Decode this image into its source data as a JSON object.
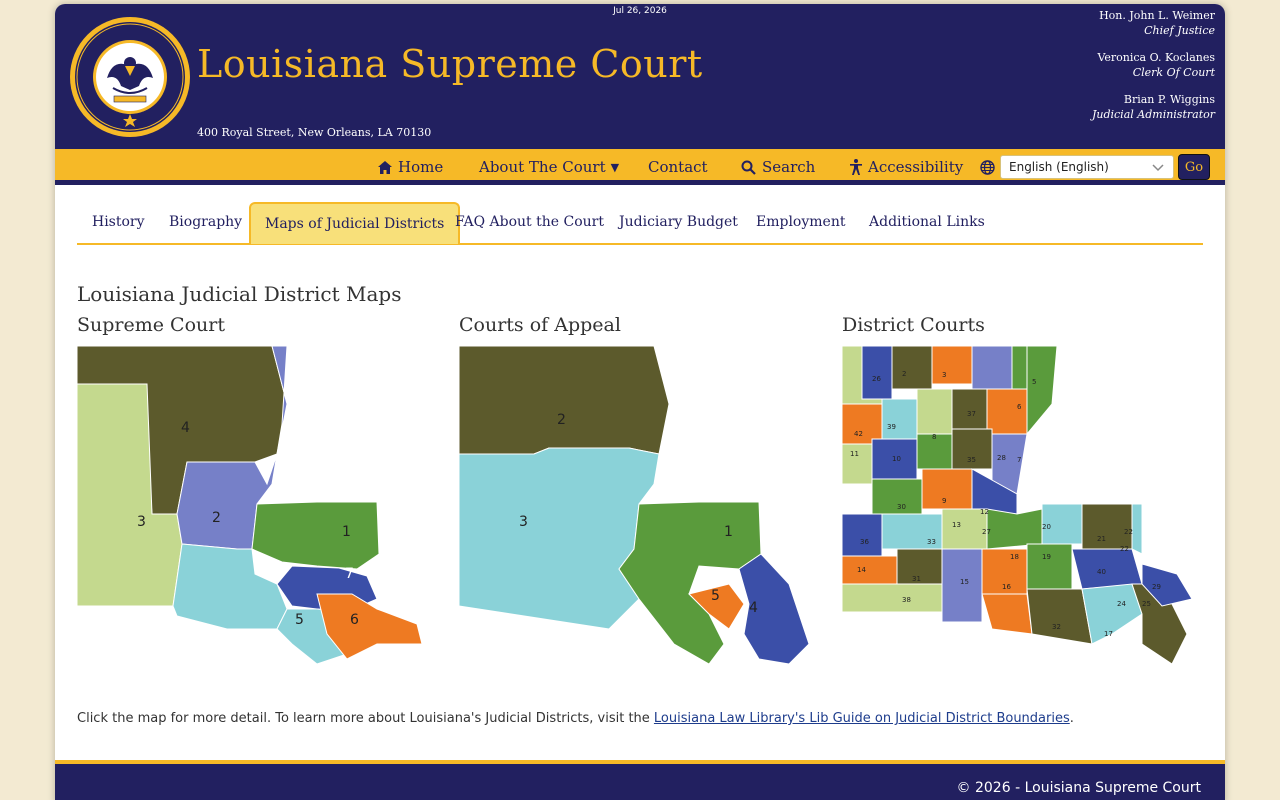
{
  "header": {
    "date": "Jul 26, 2026",
    "title": "Louisiana Supreme Court",
    "address": "400 Royal Street, New Orleans, LA 70130",
    "officials": [
      {
        "name": "Hon. John L. Weimer",
        "role": "Chief Justice"
      },
      {
        "name": "Veronica O. Koclanes",
        "role": "Clerk Of Court"
      },
      {
        "name": "Brian P. Wiggins",
        "role": "Judicial Administrator"
      }
    ]
  },
  "nav": {
    "home": "Home",
    "about": "About The Court",
    "contact": "Contact",
    "search": "Search",
    "accessibility": "Accessibility",
    "language": "English (English)",
    "go": "Go"
  },
  "tabs": [
    "History",
    "Biography",
    "Maps of Judicial Districts",
    "FAQ About the Court",
    "Judiciary Budget",
    "Employment",
    "Additional Links"
  ],
  "main": {
    "heading": "Louisiana Judicial District Maps",
    "maps": [
      {
        "title": "Supreme Court",
        "labels": [
          "1",
          "2",
          "3",
          "4",
          "5",
          "6",
          "7"
        ]
      },
      {
        "title": "Courts of Appeal",
        "labels": [
          "1",
          "2",
          "3",
          "4",
          "5"
        ]
      },
      {
        "title": "District Courts",
        "labels": [
          "1",
          "2",
          "3",
          "4",
          "5",
          "6",
          "7",
          "8",
          "9",
          "10",
          "11",
          "12",
          "13",
          "14",
          "15",
          "16",
          "17",
          "18",
          "19",
          "20",
          "21",
          "22",
          "23",
          "24",
          "25",
          "26",
          "27",
          "28",
          "29",
          "30",
          "31",
          "32",
          "33",
          "34",
          "35",
          "36",
          "37",
          "38",
          "39",
          "40",
          "41",
          "42"
        ]
      }
    ],
    "note_text": "Click the map for more detail.  To learn more about Louisiana's Judicial Districts,  visit the ",
    "note_link": "Louisiana Law Library's Lib Guide on Judicial District Boundaries",
    "note_end": "."
  },
  "footer": {
    "copyright": "© 2026 - Louisiana Supreme Court"
  },
  "colors": {
    "navy": "#222060",
    "gold": "#f6b927",
    "olive": "#5c5a2c",
    "light_green": "#c4d98e",
    "blue": "#7680c8",
    "green": "#5a9b3c",
    "cyan": "#8ad2d8",
    "orange": "#ee7a22",
    "royal": "#3b4fa8"
  }
}
